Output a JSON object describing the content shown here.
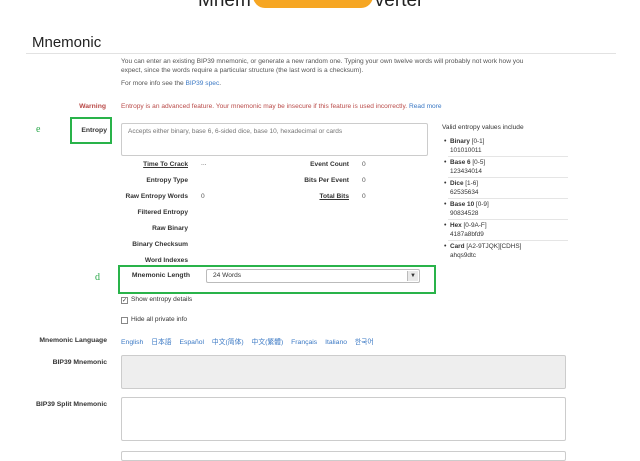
{
  "header": {
    "title_left": "Mnem",
    "title_right": "verter"
  },
  "section_title": "Mnemonic",
  "intro": {
    "text": "You can enter an existing BIP39 mnemonic, or generate a new random one. Typing your own twelve words will probably not work how you expect, since the words require a particular structure (the last word is a checksum).",
    "more_info_prefix": "For more info see the",
    "more_info_link": "BIP39 spec"
  },
  "warning": {
    "label": "Warning",
    "text": "Entropy is an advanced feature. Your mnemonic may be insecure if this feature is used incorrectly.",
    "link": "Read more"
  },
  "annotations": {
    "e": "e",
    "d": "d"
  },
  "entropy": {
    "label": "Entropy",
    "placeholder": "Accepts either binary, base 6, 6-sided dice, base 10, hexadecimal or cards"
  },
  "stats": {
    "time_to_crack_label": "Time To Crack",
    "time_to_crack_value": "...",
    "event_count_label": "Event Count",
    "event_count_value": "0",
    "entropy_type_label": "Entropy Type",
    "bits_per_event_label": "Bits Per Event",
    "bits_per_event_value": "0",
    "raw_entropy_words_label": "Raw Entropy Words",
    "raw_entropy_words_value": "0",
    "total_bits_label": "Total Bits",
    "total_bits_value": "0",
    "filtered_entropy_label": "Filtered Entropy",
    "raw_binary_label": "Raw Binary",
    "binary_checksum_label": "Binary Checksum",
    "word_indexes_label": "Word Indexes"
  },
  "valid_entropy": {
    "title": "Valid entropy values include",
    "items": [
      {
        "name": "Binary",
        "range": "[0-1]",
        "example": "101010011"
      },
      {
        "name": "Base 6",
        "range": "[0-5]",
        "example": "123434014"
      },
      {
        "name": "Dice",
        "range": "[1-6]",
        "example": "62535634"
      },
      {
        "name": "Base 10",
        "range": "[0-9]",
        "example": "90834528"
      },
      {
        "name": "Hex",
        "range": "[0-9A-F]",
        "example": "4187a8bfd9"
      },
      {
        "name": "Card",
        "range": "[A2-9TJQK][CDHS]",
        "example": "ahqs9dtc"
      }
    ]
  },
  "mnemonic_length": {
    "label": "Mnemonic Length",
    "value": "24 Words"
  },
  "options": {
    "show_entropy_details": "Show entropy details",
    "show_entropy_checked": true,
    "hide_private_info": "Hide all private info",
    "hide_private_checked": false
  },
  "mnemonic_language": {
    "label": "Mnemonic Language",
    "languages": [
      "English",
      "日本語",
      "Español",
      "中文(简体)",
      "中文(繁體)",
      "Français",
      "Italiano",
      "한국어"
    ]
  },
  "bip39_mnemonic": {
    "label": "BIP39 Mnemonic"
  },
  "bip39_split_mnemonic": {
    "label": "BIP39 Split Mnemonic"
  },
  "colors": {
    "accent": "#3a78c4",
    "warning": "#b94a48",
    "highlight": "#29b34a",
    "title_highlight": "#f6a623"
  }
}
